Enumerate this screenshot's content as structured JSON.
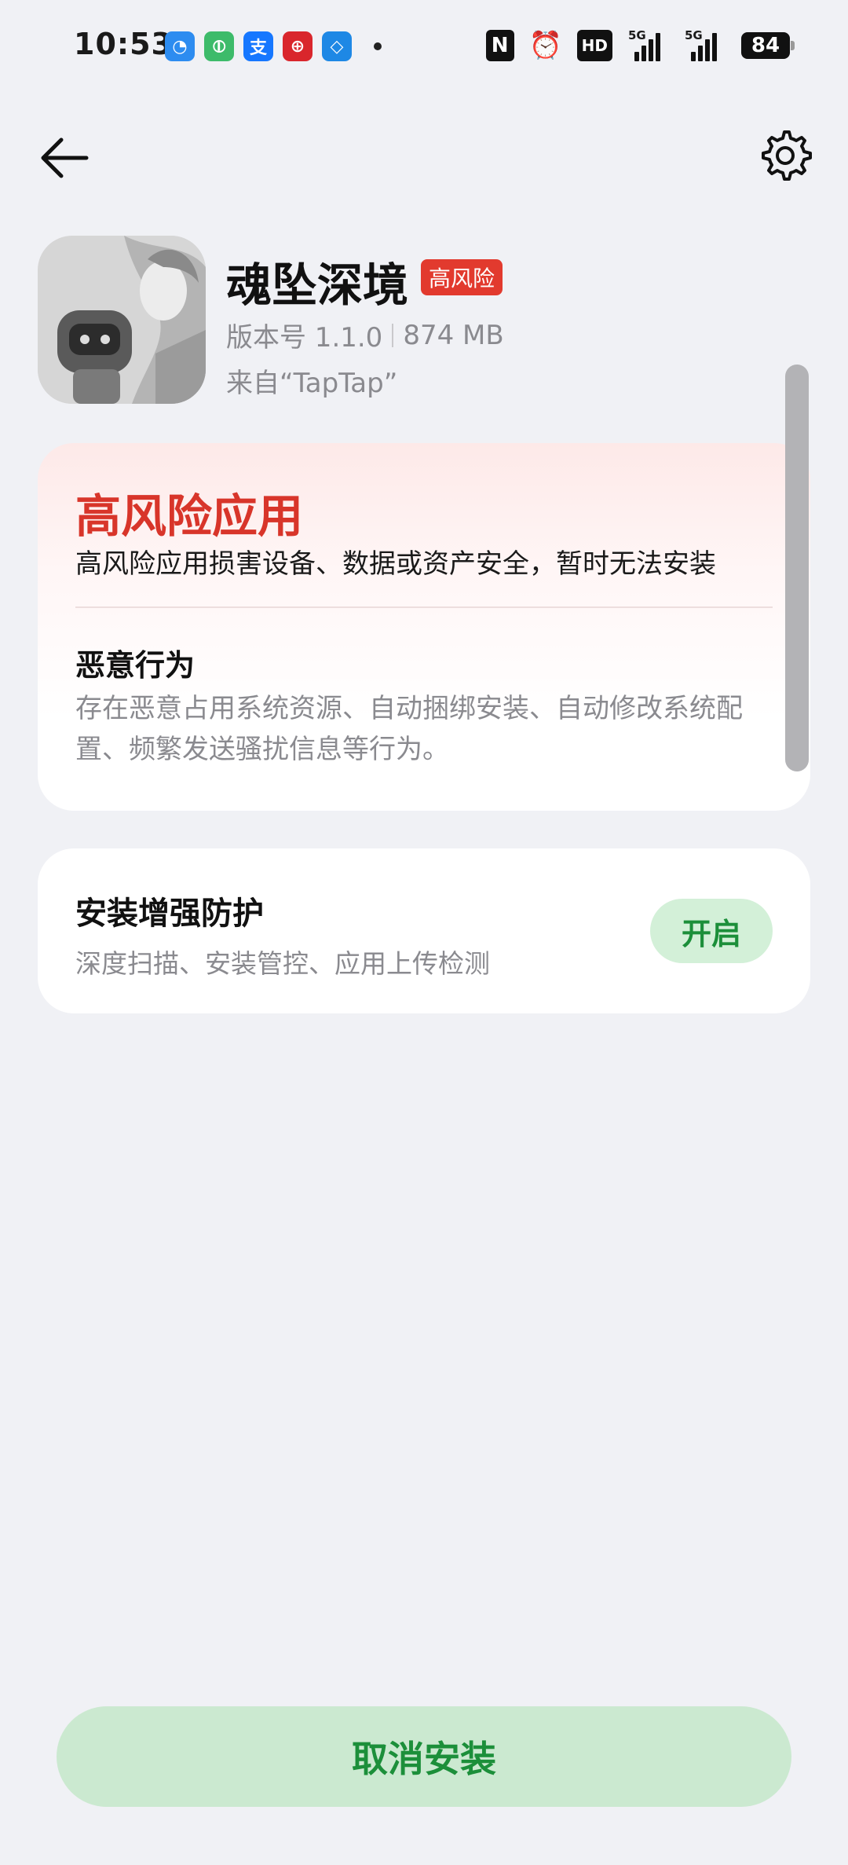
{
  "status_bar": {
    "time": "10:53",
    "notification_icons": [
      {
        "name": "app-notif-icon-1",
        "glyph": "◔",
        "color": "#2d8cf0"
      },
      {
        "name": "app-notif-icon-2",
        "glyph": "⦶",
        "color": "#3dbb6a"
      },
      {
        "name": "alipay-icon",
        "glyph": "支",
        "color": "#1677ff"
      },
      {
        "name": "bank-icon",
        "glyph": "⊕",
        "color": "#d9262c"
      },
      {
        "name": "app-notif-icon-5",
        "glyph": "◇",
        "color": "#1e88e5"
      }
    ],
    "nfc_label": "N",
    "hd_label": "HD",
    "signal_1_label": "5G",
    "signal_2_label": "5G",
    "battery": "84"
  },
  "app": {
    "name": "魂坠深境",
    "risk_badge": "高风险",
    "version": "版本号 1.1.0",
    "size": "874 MB",
    "source": "来自“TapTap”"
  },
  "warning": {
    "title": "高风险应用",
    "description": "高风险应用损害设备、数据或资产安全，暂时无法安装",
    "behavior_title": "恶意行为",
    "behavior_description": "存在恶意占用系统资源、自动捆绑安装、自动修改系统配置、频繁发送骚扰信息等行为。"
  },
  "protection": {
    "title": "安装增强防护",
    "description": "深度扫描、安装管控、应用上传检测",
    "button_label": "开启"
  },
  "footer": {
    "cancel_label": "取消安装"
  },
  "colors": {
    "accent_green": "#1c8f3a",
    "risk_red": "#d8352a",
    "badge_red": "#e23a2e"
  }
}
